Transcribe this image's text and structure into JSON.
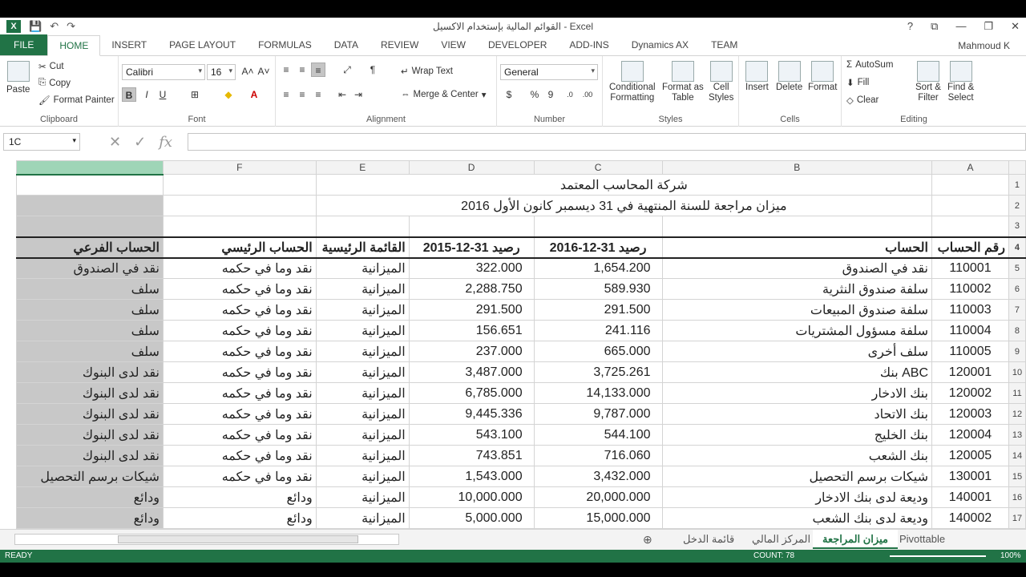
{
  "window": {
    "title": "القوائم المالية بإستخدام الاكسيل - Excel",
    "help": "?",
    "user": "Mahmoud K"
  },
  "qat": {
    "logo": "X",
    "save_icon": "💾",
    "undo_icon": "↶",
    "redo_icon": "↷"
  },
  "tabs": [
    "FILE",
    "HOME",
    "INSERT",
    "PAGE LAYOUT",
    "FORMULAS",
    "DATA",
    "REVIEW",
    "VIEW",
    "DEVELOPER",
    "ADD-INS",
    "Dynamics AX",
    "TEAM"
  ],
  "ribbon": {
    "clipboard": {
      "paste": "Paste",
      "cut": "Cut",
      "copy": "Copy",
      "format_painter": "Format Painter",
      "label": "Clipboard"
    },
    "font": {
      "name": "Calibri",
      "size": "16",
      "bold": "B",
      "italic": "I",
      "underline": "U",
      "label": "Font"
    },
    "alignment": {
      "wrap": "Wrap Text",
      "merge": "Merge & Center",
      "label": "Alignment"
    },
    "number": {
      "format": "General",
      "currency": "$",
      "percent": "%",
      "comma": "9",
      "label": "Number"
    },
    "styles": {
      "conditional": "Conditional",
      "conditional2": "Formatting",
      "format_as": "Format as",
      "table": "Table",
      "cell": "Cell",
      "styles": "Styles",
      "label": "Styles"
    },
    "cells": {
      "insert": "Insert",
      "delete": "Delete",
      "format": "Format",
      "label": "Cells"
    },
    "editing": {
      "autosum": "AutoSum",
      "fill": "Fill",
      "clear": "Clear",
      "sort": "Sort &",
      "filter": "Filter",
      "find": "Find &",
      "select": "Select",
      "label": "Editing"
    }
  },
  "formula_bar": {
    "name_box": "1C",
    "fx": "fx",
    "value": ""
  },
  "columns": {
    "G": "",
    "F": "F",
    "E": "E",
    "D": "D",
    "C": "C",
    "B": "B",
    "A": "A"
  },
  "sheet": {
    "company": "شركة المحاسب المعتمد",
    "subtitle": "ميزان مراجعة للسنة المنتهية في 31 ديسمبر كانون الأول 2016",
    "headers": [
      "رقم الحساب",
      "الحساب",
      "رصيد 31-12-2016",
      "رصيد 31-12-2015",
      "القائمة الرئيسية",
      "الحساب الرئيسي",
      "الحساب الفرعي"
    ],
    "rows": [
      [
        "110001",
        "نقد في الصندوق",
        "1,654.200",
        "322.000",
        "الميزانية",
        "نقد وما في حكمه",
        "نقد في الصندوق"
      ],
      [
        "110002",
        "سلفة صندوق النثرية",
        "589.930",
        "2,288.750",
        "الميزانية",
        "نقد وما في حكمه",
        "سلف"
      ],
      [
        "110003",
        "سلفة صندوق المبيعات",
        "291.500",
        "291.500",
        "الميزانية",
        "نقد وما في حكمه",
        "سلف"
      ],
      [
        "110004",
        "سلفة مسؤول المشتريات",
        "241.116",
        "156.651",
        "الميزانية",
        "نقد وما في حكمه",
        "سلف"
      ],
      [
        "110005",
        "سلف أخرى",
        "665.000",
        "237.000",
        "الميزانية",
        "نقد وما في حكمه",
        "سلف"
      ],
      [
        "120001",
        "بنك ABC",
        "3,725.261",
        "3,487.000",
        "الميزانية",
        "نقد وما في حكمه",
        "نقد لدى البنوك"
      ],
      [
        "120002",
        "بنك الادخار",
        "14,133.000",
        "6,785.000",
        "الميزانية",
        "نقد وما في حكمه",
        "نقد لدى البنوك"
      ],
      [
        "120003",
        "بنك الاتحاد",
        "9,787.000",
        "9,445.336",
        "الميزانية",
        "نقد وما في حكمه",
        "نقد لدى البنوك"
      ],
      [
        "120004",
        "بنك الخليج",
        "544.100",
        "543.100",
        "الميزانية",
        "نقد وما في حكمه",
        "نقد لدى البنوك"
      ],
      [
        "120005",
        "بنك الشعب",
        "716.060",
        "743.851",
        "الميزانية",
        "نقد وما في حكمه",
        "نقد لدى البنوك"
      ],
      [
        "130001",
        "شيكات برسم التحصيل",
        "3,432.000",
        "1,543.000",
        "الميزانية",
        "نقد وما في حكمه",
        "شيكات برسم التحصيل"
      ],
      [
        "140001",
        "وديعة لدى بنك الادخار",
        "20,000.000",
        "10,000.000",
        "الميزانية",
        "ودائع",
        "ودائع"
      ],
      [
        "140002",
        "وديعة لدى بنك الشعب",
        "15,000.000",
        "5,000.000",
        "الميزانية",
        "ودائع",
        "ودائع"
      ]
    ]
  },
  "sheet_tabs": [
    "Pivottable",
    "ميزان المراجعة",
    "المركز المالي",
    "قائمة الدخل"
  ],
  "status": {
    "ready": "READY",
    "count": "COUNT: 78",
    "zoom": "100%"
  }
}
